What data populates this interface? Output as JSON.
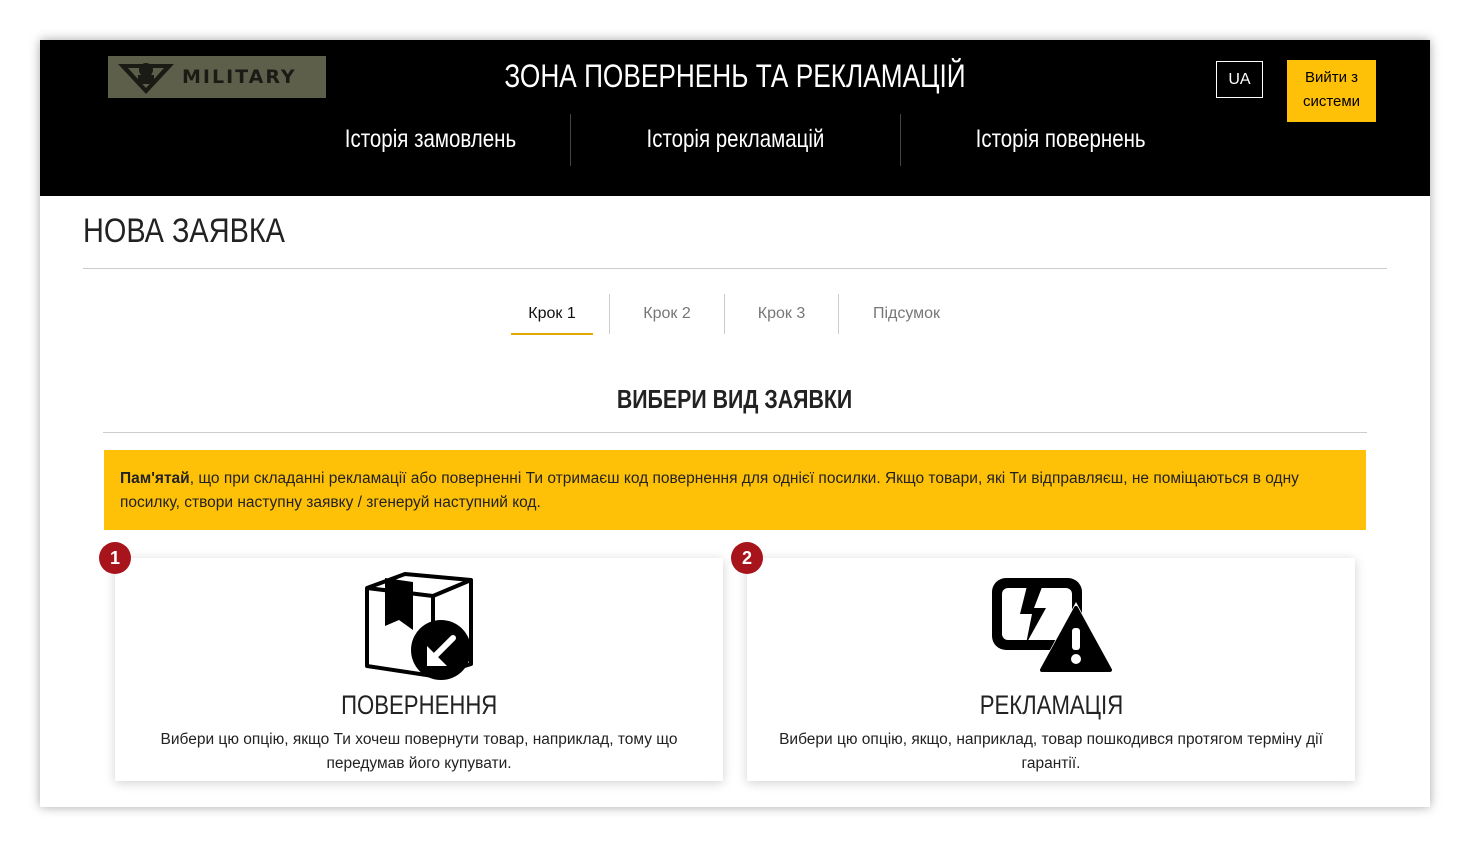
{
  "header": {
    "logo_text": "MILITARY",
    "title": "ЗОНА ПОВЕРНЕНЬ ТА РЕКЛАМАЦІЙ",
    "lang_label": "UA",
    "logout_label": "Вийти з системи",
    "nav": [
      {
        "label": "Історія замовлень"
      },
      {
        "label": "Історія рекламацій"
      },
      {
        "label": "Історія повернень"
      }
    ]
  },
  "page": {
    "title": "НОВА ЗАЯВКА",
    "steps": [
      {
        "label": "Крок 1",
        "active": true
      },
      {
        "label": "Крок 2",
        "active": false
      },
      {
        "label": "Крок 3",
        "active": false
      },
      {
        "label": "Підсумок",
        "active": false
      }
    ],
    "section_title": "ВИБЕРИ ВИД ЗАЯВКИ",
    "notice": {
      "bold": "Пам'ятай",
      "text": ", що при складанні рекламації або поверненні Ти отримаєш код повернення для однієї посилки. Якщо товари, які Ти відправляєш, не поміщаються в одну посилку, створи наступну заявку / згенеруй наступний код."
    },
    "options": [
      {
        "badge": "1",
        "icon": "box-return-icon",
        "title": "ПОВЕРНЕННЯ",
        "description": "Вибери цю опцію, якщо Ти хочеш повернути товар, наприклад, тому що передумав його купувати."
      },
      {
        "badge": "2",
        "icon": "broken-device-warning-icon",
        "title": "РЕКЛАМАЦІЯ",
        "description": "Вибери цю опцію, якщо, наприклад, товар пошкодився протягом терміну дії гарантії."
      }
    ]
  },
  "colors": {
    "header_bg": "#000000",
    "accent": "#ffc107",
    "badge": "#a8141b",
    "logo_bg": "#5e5f4a"
  }
}
